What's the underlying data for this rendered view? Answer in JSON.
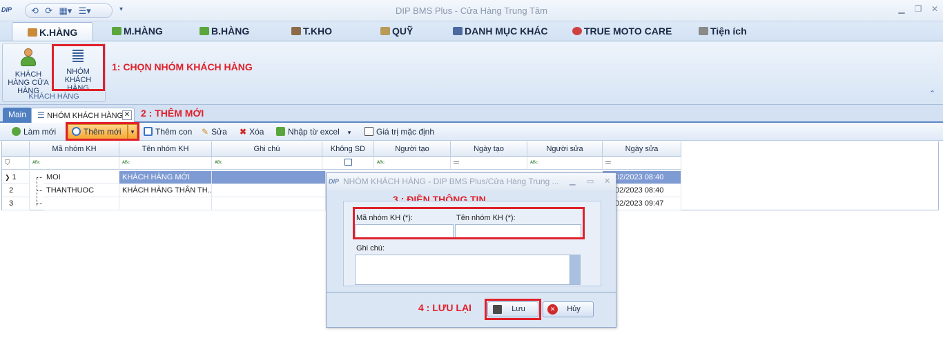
{
  "app": {
    "title": "DIP BMS Plus - Cửa Hàng Trung Tâm",
    "logo_text": "DIP"
  },
  "ribbon_tabs": [
    {
      "label": "K.HÀNG",
      "icon": "customer-icon"
    },
    {
      "label": "M.HÀNG",
      "icon": "cart-icon"
    },
    {
      "label": "B.HÀNG",
      "icon": "cart-icon"
    },
    {
      "label": "T.KHO",
      "icon": "warehouse-icon"
    },
    {
      "label": "QUỸ",
      "icon": "cash-icon"
    },
    {
      "label": "DANH MỤC KHÁC",
      "icon": "list-icon"
    },
    {
      "label": "TRUE MOTO CARE",
      "icon": "moto-icon"
    },
    {
      "label": "Tiện ích",
      "icon": "tools-icon"
    }
  ],
  "ribbon": {
    "btn_customer_store": "KHÁCH HÀNG CỬA HÀNG",
    "btn_customer_group": "NHÓM KHÁCH HÀNG",
    "group_label": "KHÁCH HÀNG"
  },
  "annotations": {
    "step1": "1: CHỌN NHÓM KHÁCH HÀNG",
    "step2": "2 : THÊM MỚI",
    "step3": "3 : ĐIỀN THÔNG TIN",
    "step4": "4 : LƯU LẠI",
    "color": "#e0202a"
  },
  "doc_tabs": {
    "main": "Main",
    "group": "NHÓM KHÁCH HÀNG"
  },
  "toolbar": {
    "refresh": "Làm mới",
    "add": "Thêm mới",
    "add_child": "Thêm con",
    "edit": "Sửa",
    "delete": "Xóa",
    "import": "Nhập từ excel",
    "defaults": "Giá trị mặc định"
  },
  "grid": {
    "columns": [
      "Mã nhóm KH",
      "Tên nhóm KH",
      "Ghi chú",
      "Không SD",
      "Người tạo",
      "Ngày tạo",
      "Người sửa",
      "Ngày sửa"
    ],
    "rows": [
      {
        "num": "1",
        "code": "MOI",
        "name": "KHÁCH HÀNG MỚI",
        "modified": "02/2023 08:40"
      },
      {
        "num": "2",
        "code": "THANTHUOC",
        "name": "KHÁCH HÀNG THÂN TH...",
        "modified": "02/2023 08:40"
      },
      {
        "num": "3",
        "code": "",
        "name": "",
        "modified": "02/2023 09:47"
      }
    ]
  },
  "dialog": {
    "title": "NHÓM KHÁCH HÀNG - DIP BMS Plus/Cửa Hàng Trung ...",
    "code_label": "Mã nhóm KH (*):",
    "name_label": "Tên nhóm KH (*):",
    "note_label": "Ghi chú:",
    "save": "Lưu",
    "cancel": "Hủy"
  }
}
